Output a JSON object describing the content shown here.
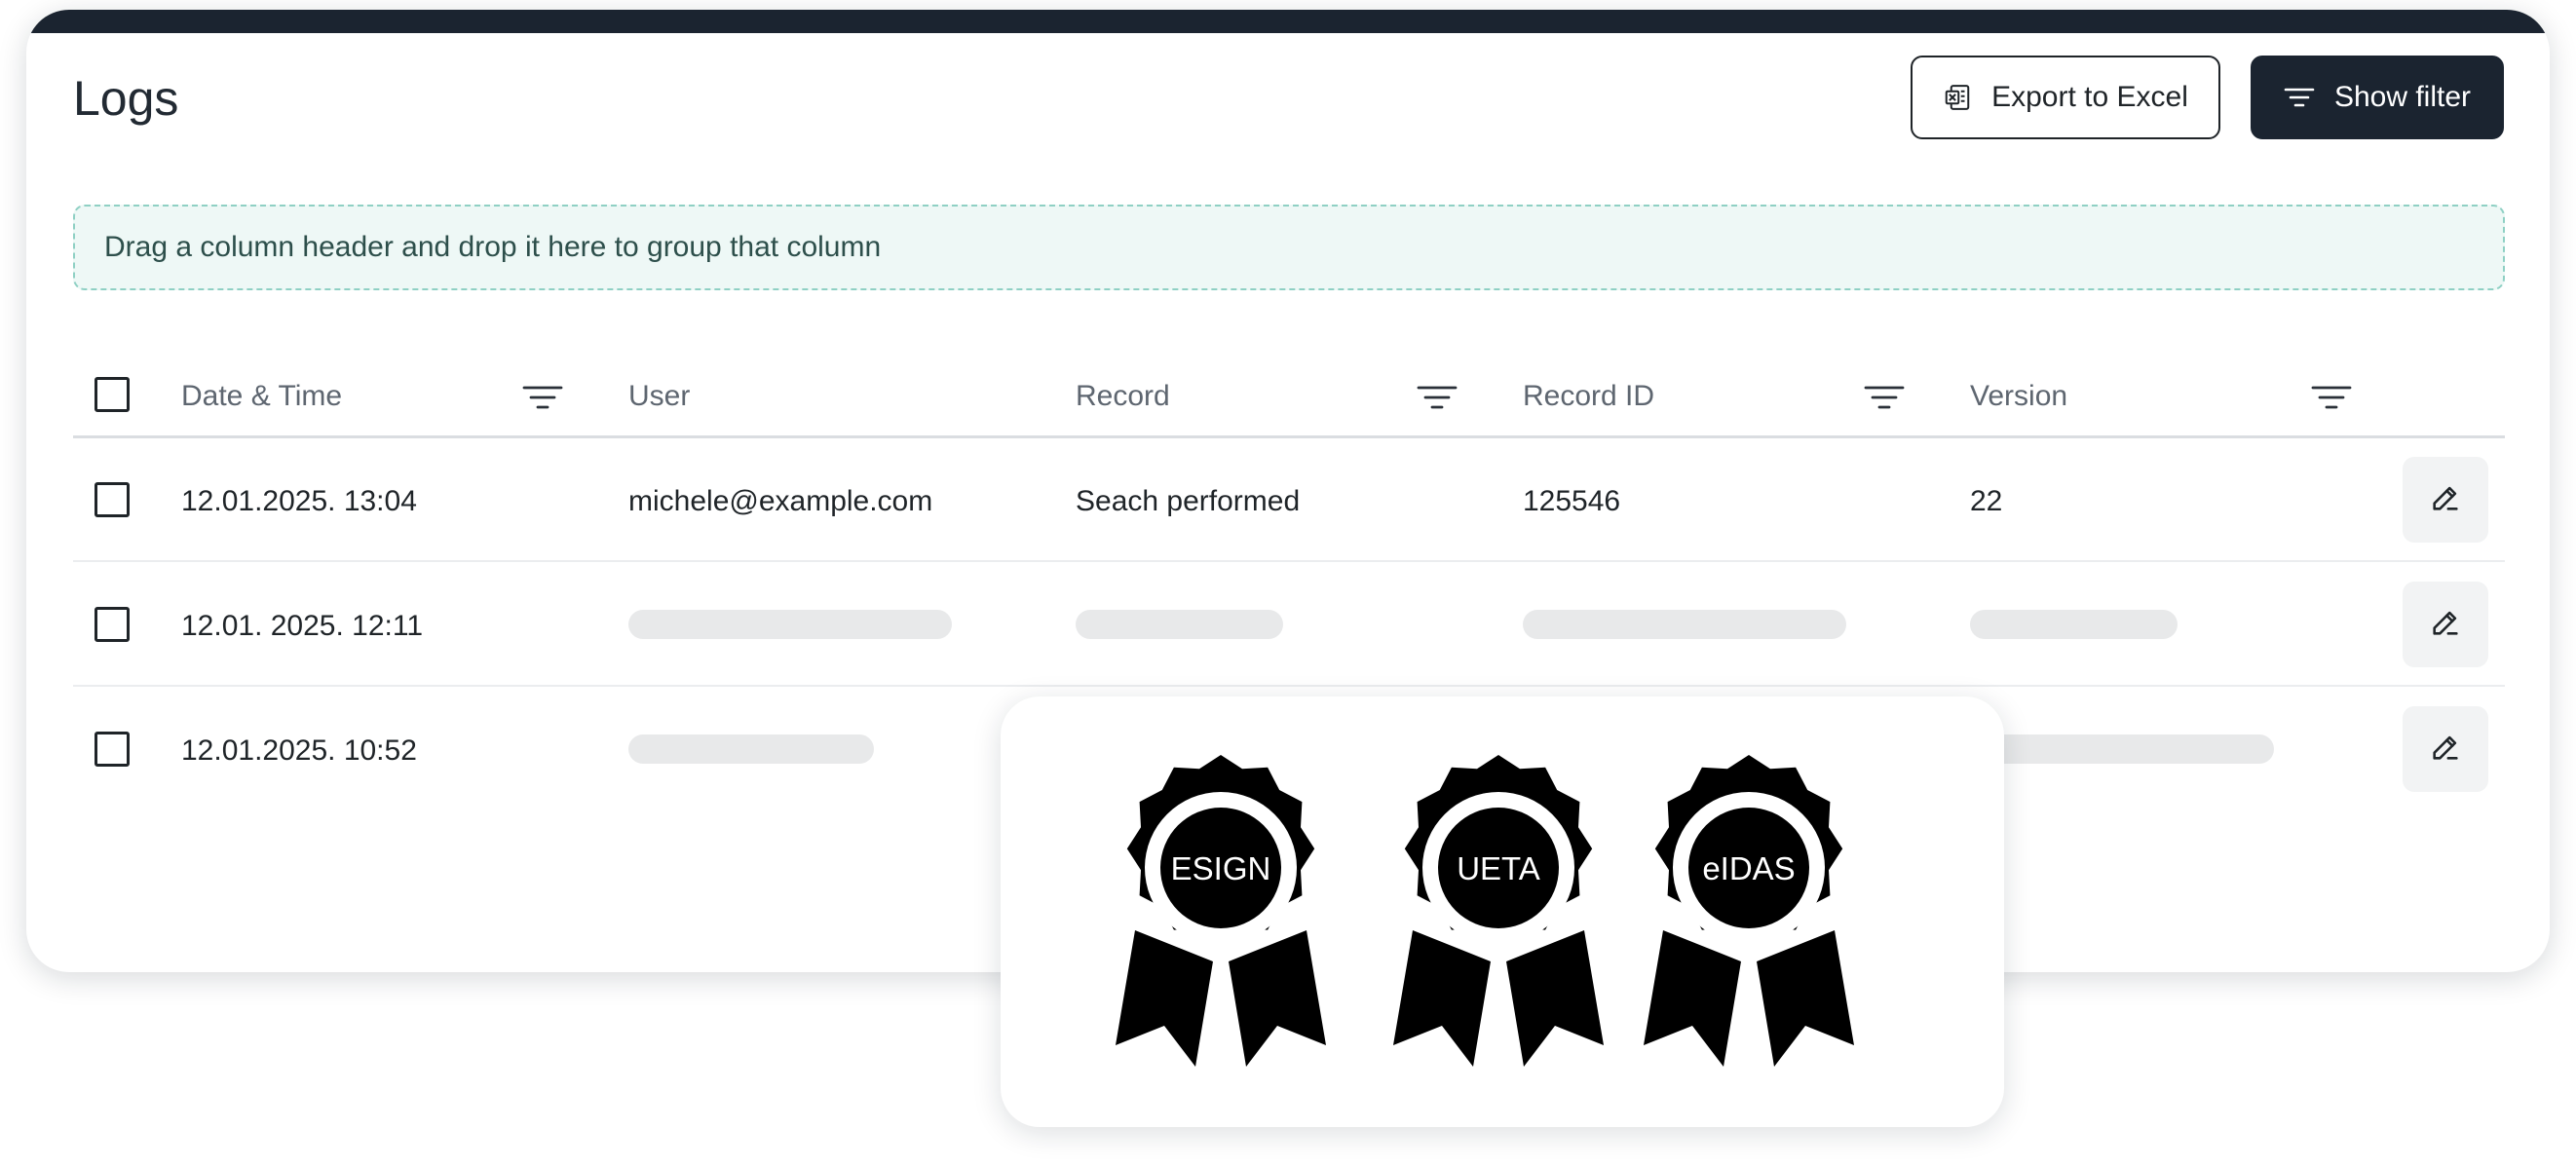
{
  "page": {
    "title": "Logs",
    "export_label": "Export to Excel",
    "filter_label": "Show filter",
    "group_hint": "Drag a column header and drop it here to group that column"
  },
  "table": {
    "columns": [
      "Date & Time",
      "User",
      "Record",
      "Record ID",
      "Version"
    ],
    "rows": [
      {
        "datetime": "12.01.2025. 13:04",
        "user": "michele@example.com",
        "record": "Seach performed",
        "record_id": "125546",
        "version": "22"
      },
      {
        "datetime": "12.01. 2025. 12:11"
      },
      {
        "datetime": "12.01.2025. 10:52"
      }
    ]
  },
  "badges": [
    "ESIGN",
    "UETA",
    "eIDAS"
  ],
  "icons": {
    "export": "excel-icon",
    "filter": "filter-icon",
    "edit": "pencil-icon",
    "badge": "award-ribbon-icon"
  },
  "colors": {
    "dark": "#1b2430",
    "drop_zone_bg": "#eef8f6",
    "drop_zone_border": "#8fd0c4",
    "skeleton": "#e8e9ea"
  }
}
